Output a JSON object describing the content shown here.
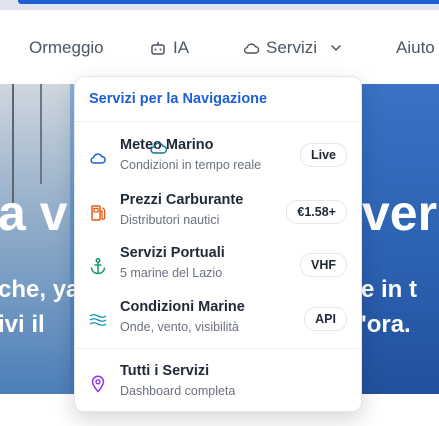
{
  "nav": {
    "items": [
      {
        "label": "Ormeggio"
      },
      {
        "label": "IA",
        "icon": "robot-icon"
      },
      {
        "label": "Servizi",
        "icon": "cloud-icon",
        "trailing_icon": "chevron-down-icon"
      },
      {
        "label": "Aiuto"
      }
    ]
  },
  "hero": {
    "big_left": "a v",
    "big_right": "ver",
    "line1_left": "che, ya",
    "line1_right": "e in t",
    "line2_left": "ivi il",
    "line2_right": "'ora."
  },
  "dropdown": {
    "header": "Servizi per la Navigazione",
    "items": [
      {
        "title": "Meteo Marino",
        "desc": "Condizioni in tempo reale",
        "badge": "Live",
        "icon": "cloud-icon",
        "icon_color": "#1d5fd6"
      },
      {
        "title": "Prezzi Carburante",
        "desc": "Distributori nautici",
        "badge": "€1.58+",
        "icon": "fuel-pump-icon",
        "icon_color": "#ea580c"
      },
      {
        "title": "Servizi Portuali",
        "desc": "5 marine del Lazio",
        "badge": "VHF",
        "icon": "anchor-icon",
        "icon_color": "#059669"
      },
      {
        "title": "Condizioni Marine",
        "desc": "Onde, vento, visibilità",
        "badge": "API",
        "icon": "waves-icon",
        "icon_color": "#0891b2"
      },
      {
        "title": "Tutti i Servizi",
        "desc": "Dashboard completa",
        "icon": "map-pin-icon",
        "icon_color": "#9333ea"
      }
    ]
  },
  "floating_icons": [
    {
      "icon": "smiley-cloud-icon",
      "color": "#0e7490"
    },
    {
      "icon": "copy-icon",
      "color": "#0e7490"
    },
    {
      "icon": "drop-icon",
      "color": "#1d5fd6"
    }
  ]
}
